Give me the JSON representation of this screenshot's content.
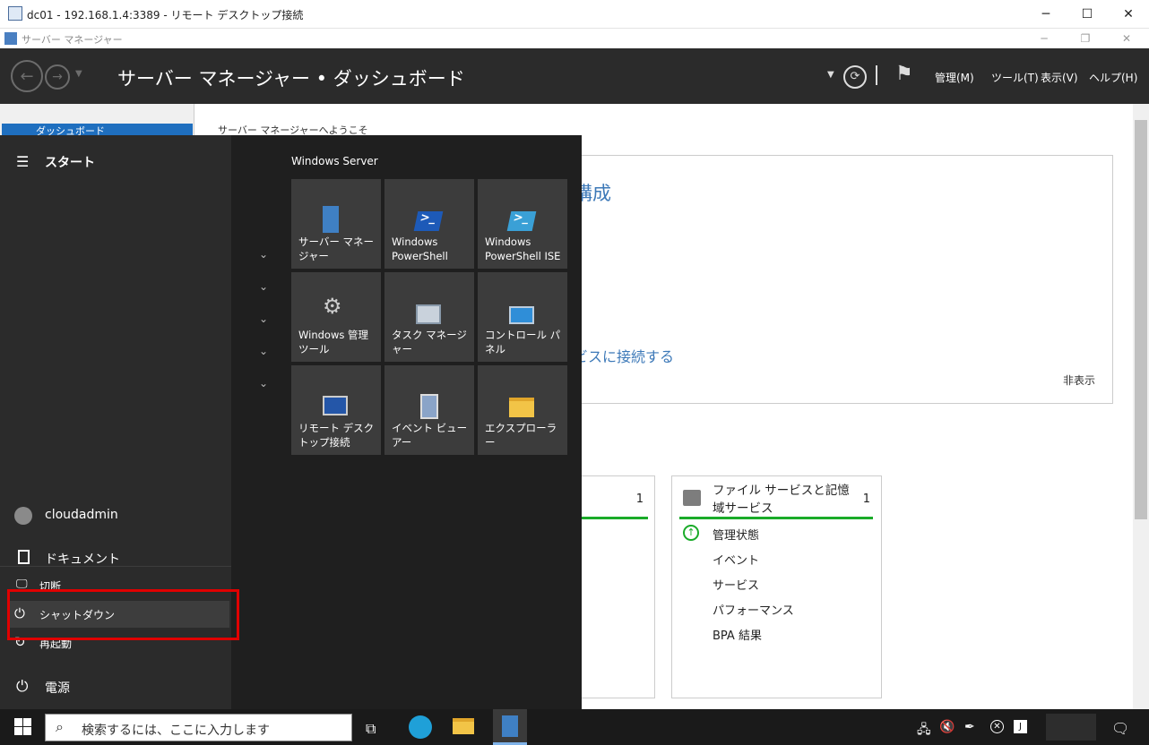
{
  "rdp_window": {
    "title": "dc01 - 192.168.1.4:3389 - リモート デスクトップ接続",
    "minimize": "─",
    "maximize": "☐",
    "close": "✕"
  },
  "sm_window": {
    "title": "サーバー マネージャー",
    "minimize": "─",
    "restore": "❐",
    "close": "✕"
  },
  "header": {
    "breadcrumb": "サーバー マネージャー • ダッシュボード",
    "menus": [
      "管理(M)",
      "ツール(T)",
      "表示(V)",
      "ヘルプ(H)"
    ]
  },
  "sidebar": {
    "dashboard": "ダッシュボード"
  },
  "main": {
    "welcome": "サーバー マネージャーへようこそ",
    "quick_title_fragment": "構成",
    "quick_link_fragment": "ビスに接続する",
    "hide": "非表示",
    "tile1_count": "1",
    "tile2": {
      "title": "ファイル サービスと記憶域サービス",
      "count": "1",
      "items": [
        "管理状態",
        "イベント",
        "サービス",
        "パフォーマンス",
        "BPA 結果"
      ]
    }
  },
  "start_menu": {
    "title": "スタート",
    "user": "cloudadmin",
    "documents": "ドキュメント",
    "power": "電源",
    "power_options": [
      "切断",
      "シャットダウン",
      "再起動"
    ],
    "group_title": "Windows Server",
    "tiles": [
      {
        "label": "サーバー マネージャー",
        "icon": "server-manager-icon"
      },
      {
        "label": "Windows PowerShell",
        "icon": "powershell-icon"
      },
      {
        "label": "Windows PowerShell ISE",
        "icon": "powershell-ise-icon"
      },
      {
        "label": "Windows 管理ツール",
        "icon": "admin-tools-icon"
      },
      {
        "label": "タスク マネージャー",
        "icon": "task-manager-icon"
      },
      {
        "label": "コントロール パネル",
        "icon": "control-panel-icon"
      },
      {
        "label": "リモート デスクトップ接続",
        "icon": "remote-desktop-icon"
      },
      {
        "label": "イベント ビューアー",
        "icon": "event-viewer-icon"
      },
      {
        "label": "エクスプローラー",
        "icon": "explorer-icon"
      }
    ]
  },
  "taskbar": {
    "search_placeholder": "検索するには、ここに入力します"
  },
  "colors": {
    "accent": "#1f6fbf",
    "highlight": "#e00000",
    "status_green": "#1aab29"
  }
}
